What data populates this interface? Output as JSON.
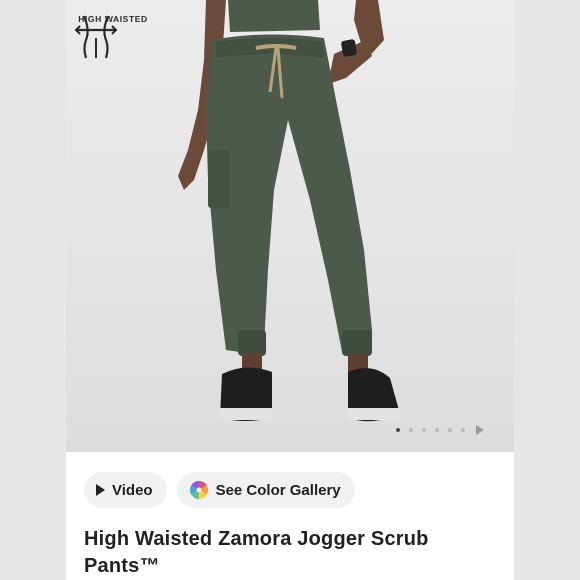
{
  "badge": {
    "label": "HIGH WAISTED",
    "icon": "high-waisted-icon"
  },
  "carousel": {
    "total_dots": 6,
    "active_index": 0
  },
  "buttons": {
    "video": {
      "label": "Video",
      "icon": "play-icon"
    },
    "gallery": {
      "label": "See Color Gallery",
      "icon": "color-wheel-icon"
    }
  },
  "product": {
    "title": "High Waisted Zamora Jogger Scrub Pants™"
  },
  "colors": {
    "pants": "#4b5a4b",
    "drawstring": "#b9a27a",
    "background": "#e6e6e6"
  }
}
